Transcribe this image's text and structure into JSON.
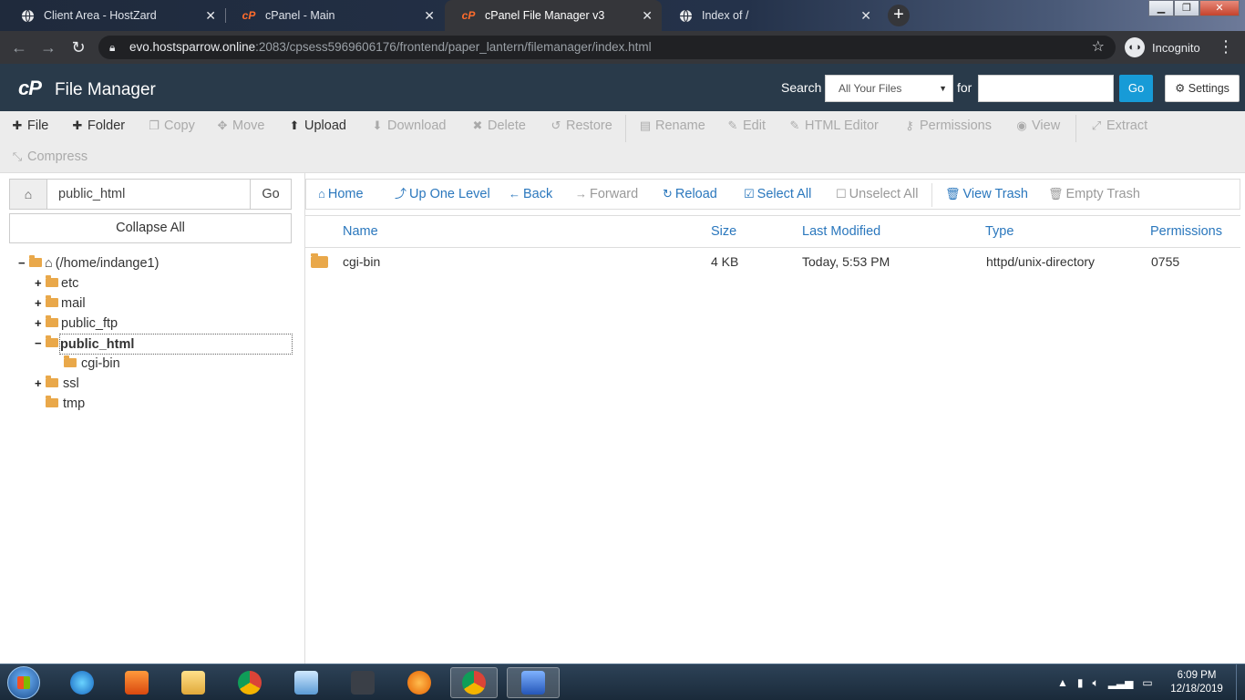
{
  "browser": {
    "tabs": [
      {
        "title": "Client Area - HostZard",
        "icon": "globe-icon",
        "active": false
      },
      {
        "title": "cPanel - Main",
        "icon": "cpanel-icon",
        "active": false
      },
      {
        "title": "cPanel File Manager v3",
        "icon": "cpanel-icon",
        "active": true
      },
      {
        "title": "Index of /",
        "icon": "globe-icon",
        "active": false
      }
    ],
    "url_host": "evo.hostsparrow.online",
    "url_rest": ":2083/cpsess5969606176/frontend/paper_lantern/filemanager/index.html",
    "profile_label": "Incognito"
  },
  "header": {
    "logo": "cP",
    "title": "File Manager",
    "search_label": "Search",
    "search_scope": "All Your Files",
    "for_label": "for",
    "search_value": "",
    "go_label": "Go",
    "settings_label": "Settings"
  },
  "toolbar": {
    "file": "File",
    "folder": "Folder",
    "copy": "Copy",
    "move": "Move",
    "upload": "Upload",
    "download": "Download",
    "delete": "Delete",
    "restore": "Restore",
    "rename": "Rename",
    "edit": "Edit",
    "html_editor": "HTML Editor",
    "permissions": "Permissions",
    "view": "View",
    "extract": "Extract",
    "compress": "Compress"
  },
  "sidebar": {
    "path_value": "public_html",
    "go_label": "Go",
    "collapse_label": "Collapse All",
    "tree": [
      {
        "toggle": "−",
        "label": "(/home/indange1)"
      },
      {
        "toggle": "+",
        "label": "etc"
      },
      {
        "toggle": "+",
        "label": "mail"
      },
      {
        "toggle": "+",
        "label": "public_ftp"
      },
      {
        "toggle": "−",
        "label": "public_html"
      },
      {
        "toggle": "",
        "label": "cgi-bin"
      },
      {
        "toggle": "+",
        "label": "ssl"
      },
      {
        "toggle": "",
        "label": "tmp"
      }
    ]
  },
  "navbar": {
    "home": "Home",
    "up": "Up One Level",
    "back": "Back",
    "forward": "Forward",
    "reload": "Reload",
    "select_all": "Select All",
    "unselect_all": "Unselect All",
    "view_trash": "View Trash",
    "empty_trash": "Empty Trash"
  },
  "table": {
    "columns": [
      "Name",
      "Size",
      "Last Modified",
      "Type",
      "Permissions"
    ],
    "rows": [
      {
        "name": "cgi-bin",
        "size": "4 KB",
        "modified": "Today, 5:53 PM",
        "type": "httpd/unix-directory",
        "perms": "0755"
      }
    ]
  },
  "taskbar": {
    "time": "6:09 PM",
    "date": "12/18/2019",
    "apps": [
      "internet-explorer-icon",
      "media-player-icon",
      "file-explorer-icon",
      "chrome-icon",
      "notepad-icon",
      "nox-icon",
      "firefox-icon",
      "chrome-icon",
      "malwarebytes-icon"
    ]
  },
  "colors": {
    "header_bg": "#293a4a",
    "link": "#2a77bd",
    "button_primary": "#179bd7",
    "folder": "#e9a84a"
  }
}
